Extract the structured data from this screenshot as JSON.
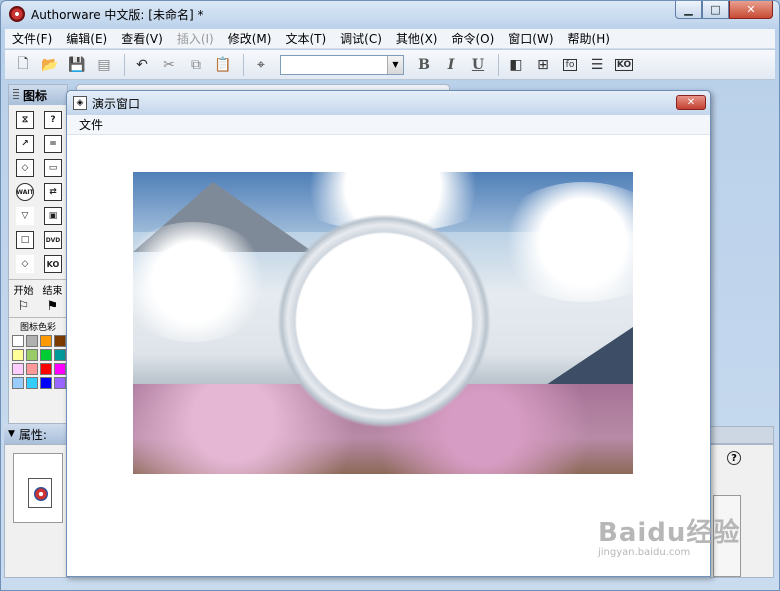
{
  "app": {
    "title": "Authorware 中文版: [未命名] *",
    "window_buttons": {
      "min": "▁",
      "max": "□",
      "close": "✕"
    }
  },
  "menubar": {
    "items": [
      {
        "label": "文件(F)",
        "disabled": false
      },
      {
        "label": "编辑(E)",
        "disabled": false
      },
      {
        "label": "查看(V)",
        "disabled": false
      },
      {
        "label": "插入(I)",
        "disabled": true
      },
      {
        "label": "修改(M)",
        "disabled": false
      },
      {
        "label": "文本(T)",
        "disabled": false
      },
      {
        "label": "调试(C)",
        "disabled": false
      },
      {
        "label": "其他(X)",
        "disabled": false
      },
      {
        "label": "命令(O)",
        "disabled": false
      },
      {
        "label": "窗口(W)",
        "disabled": false
      },
      {
        "label": "帮助(H)",
        "disabled": false
      }
    ]
  },
  "toolbar": {
    "font_value": "",
    "bold": "B",
    "italic": "I",
    "underline": "U",
    "fo_label": "fo",
    "ko_label": "KO"
  },
  "icon_panel": {
    "title": "图标",
    "start_label": "开始",
    "end_label": "结束",
    "color_label": "图标色彩",
    "swatch_colors": [
      "#ffffff",
      "#b0b0b0",
      "#ff9900",
      "#7a3a00",
      "#ffff99",
      "#99cc66",
      "#00cc33",
      "#009999",
      "#ffccff",
      "#ff9999",
      "#ff0000",
      "#ff00ff",
      "#99ccff",
      "#33ccff",
      "#0000ff",
      "#9966ff"
    ]
  },
  "properties": {
    "title": "属性:"
  },
  "presentation": {
    "title": "演示窗口",
    "menu_file": "文件"
  },
  "watermark": {
    "text": "Baidu经验",
    "url": "jingyan.baidu.com"
  }
}
